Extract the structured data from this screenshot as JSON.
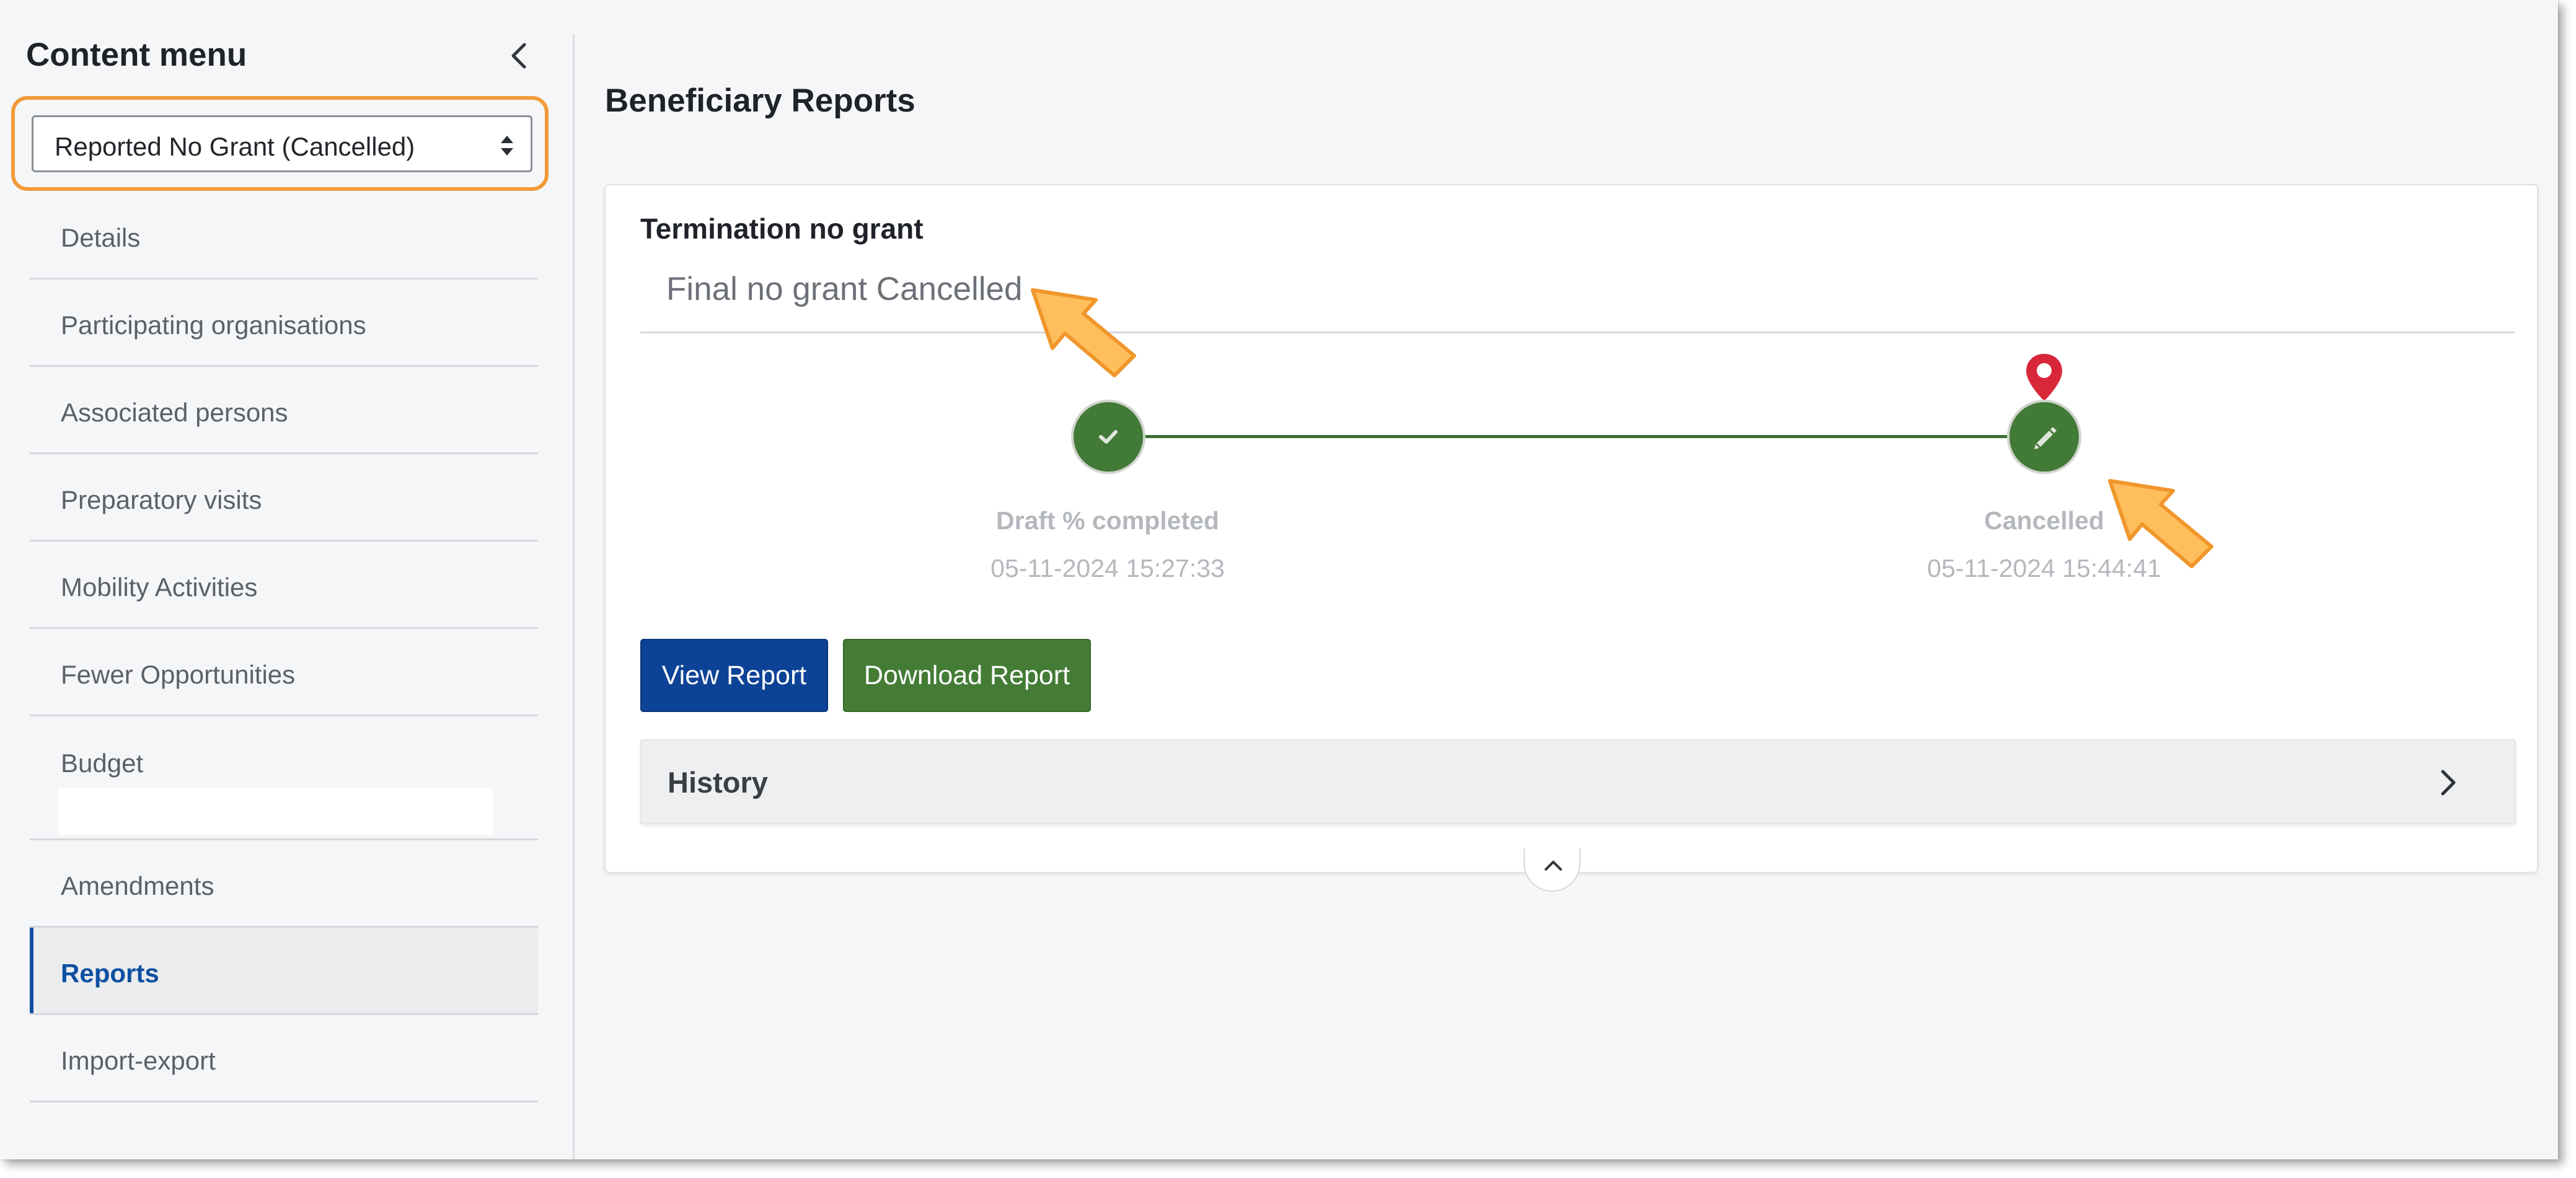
{
  "sidebar": {
    "title": "Content menu",
    "collapse_icon": "chevron-left-icon",
    "select": {
      "value": "Reported No Grant (Cancelled)"
    },
    "items": [
      {
        "label": "Details"
      },
      {
        "label": "Participating organisations"
      },
      {
        "label": "Associated persons"
      },
      {
        "label": "Preparatory visits"
      },
      {
        "label": "Mobility Activities"
      },
      {
        "label": "Fewer Opportunities"
      },
      {
        "label": "Budget"
      },
      {
        "label": "Amendments"
      },
      {
        "label": "Reports",
        "active": true
      },
      {
        "label": "Import-export"
      }
    ]
  },
  "main": {
    "title": "Beneficiary Reports",
    "report": {
      "type_label": "Termination no grant",
      "status": "Final no grant Cancelled",
      "timeline": [
        {
          "label": "Draft % completed",
          "date": "05-11-2024 15:27:33",
          "icon": "check-icon"
        },
        {
          "label": "Cancelled",
          "date": "05-11-2024 15:44:41",
          "icon": "pencil-icon",
          "current": true
        }
      ],
      "buttons": {
        "view": "View Report",
        "download": "Download Report"
      },
      "history_label": "History"
    }
  },
  "colors": {
    "accent_blue": "#0d4396",
    "success_green": "#447c36",
    "highlight_orange": "#f29a38",
    "pin_red": "#d9273a",
    "callout_arrow": "#ffbe5c"
  }
}
